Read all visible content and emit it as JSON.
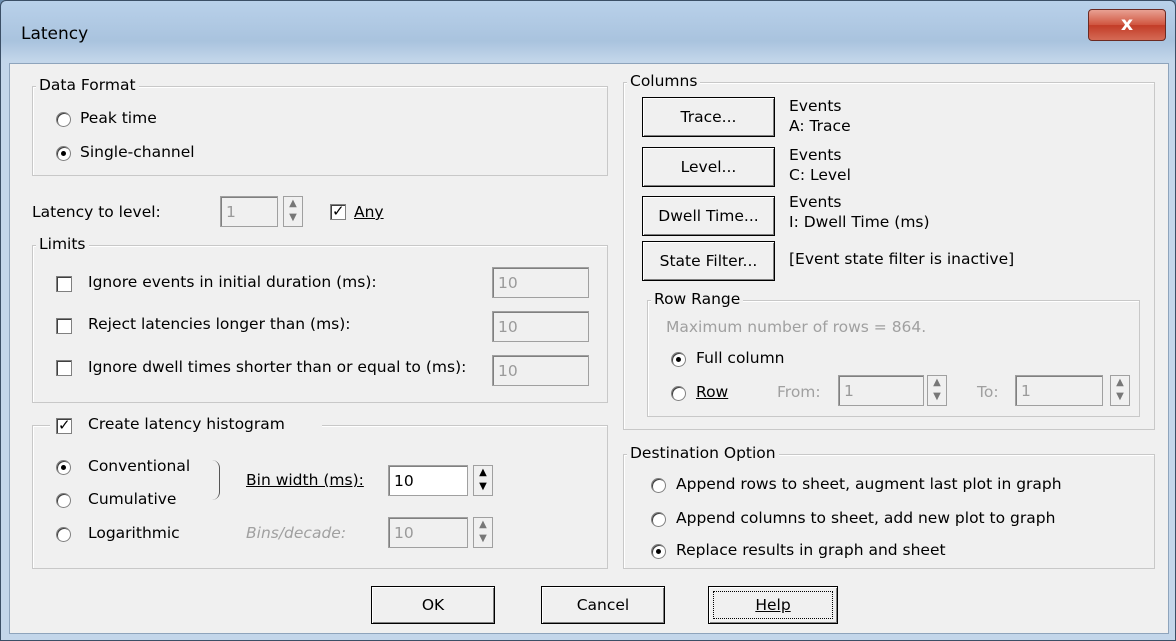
{
  "window": {
    "title": "Latency",
    "close_glyph": "x"
  },
  "data_format": {
    "label": "Data Format",
    "peak_time": "Peak time",
    "single_channel": "Single-channel",
    "selected": "single_channel"
  },
  "latency_level": {
    "label": "Latency to level:",
    "value": "1",
    "any_label": "Any",
    "any_checked": true
  },
  "limits": {
    "label": "Limits",
    "rows": [
      {
        "label": "Ignore events in initial duration (ms):",
        "value": "10",
        "checked": false
      },
      {
        "label": "Reject latencies longer than (ms):",
        "value": "10",
        "checked": false
      },
      {
        "label": "Ignore dwell times shorter than or equal to (ms):",
        "value": "10",
        "checked": false
      }
    ]
  },
  "histogram": {
    "label": "Create latency histogram",
    "checked": true,
    "conventional": "Conventional",
    "cumulative": "Cumulative",
    "logarithmic": "Logarithmic",
    "selected": "conventional",
    "bin_width_label": "Bin width (ms):",
    "bin_width_value": "10",
    "bins_decade_label": "Bins/decade:",
    "bins_decade_value": "10"
  },
  "columns": {
    "label": "Columns",
    "trace_button": "Trace...",
    "trace_info_1": "Events",
    "trace_info_2": "A: Trace",
    "level_button": "Level...",
    "level_info_1": "Events",
    "level_info_2": "C: Level",
    "dwell_button": "Dwell Time...",
    "dwell_info_1": "Events",
    "dwell_info_2": "I: Dwell Time (ms)",
    "state_button": "State Filter...",
    "state_info": "[Event state filter is inactive]"
  },
  "row_range": {
    "label": "Row Range",
    "max_rows": "Maximum number of rows = 864.",
    "full_column": "Full column",
    "row": "Row",
    "from_label": "From:",
    "from_value": "1",
    "to_label": "To:",
    "to_value": "1",
    "selected": "full_column"
  },
  "destination": {
    "label": "Destination Option",
    "append_rows": "Append rows to sheet, augment last plot in graph",
    "append_columns": "Append columns to sheet, add new plot to graph",
    "replace": "Replace results in graph and sheet",
    "selected": "replace"
  },
  "footer": {
    "ok": "OK",
    "cancel": "Cancel",
    "help": "Help"
  },
  "colors": {
    "titlebar": "#b9d1ea",
    "close_button": "#c94a33",
    "dialog_bg": "#f0f0f0"
  }
}
